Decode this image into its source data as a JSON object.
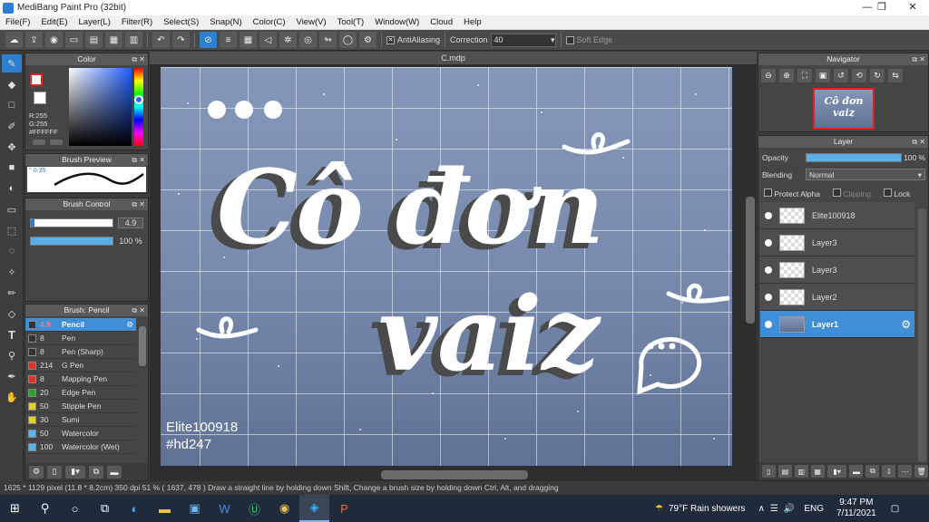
{
  "window": {
    "title": "MediBang Paint Pro (32bit)"
  },
  "menu": [
    "File(F)",
    "Edit(E)",
    "Layer(L)",
    "Filter(R)",
    "Select(S)",
    "Snap(N)",
    "Color(C)",
    "View(V)",
    "Tool(T)",
    "Window(W)",
    "Cloud",
    "Help"
  ],
  "toolbar": {
    "antialiasing_label": "AntiAliasing",
    "correction_label": "Correction",
    "correction_value": "40",
    "soft_edge_label": "Soft Edge"
  },
  "color_panel": {
    "title": "Color",
    "r_label": "R:255",
    "g_label": "G:255",
    "hex_label": "#FFFFFF",
    "primary_color": "#ffffff",
    "accent_color": "#e52222"
  },
  "brush_preview": {
    "title": "Brush Preview",
    "size_text": "0.35"
  },
  "brush_control": {
    "title": "Brush Control",
    "size_value": "4.9",
    "opacity_value": "100 %"
  },
  "brush_list": {
    "title": "Brush: Pencil",
    "items": [
      {
        "size": "4.9",
        "name": "Pencil",
        "color": "#333333",
        "selected": true
      },
      {
        "size": "8",
        "name": "Pen",
        "color": "#333333"
      },
      {
        "size": "8",
        "name": "Pen (Sharp)",
        "color": "#333333"
      },
      {
        "size": "214",
        "name": "G Pen",
        "color": "#e03030"
      },
      {
        "size": "8",
        "name": "Mapping Pen",
        "color": "#e03030"
      },
      {
        "size": "20",
        "name": "Edge Pen",
        "color": "#30a030"
      },
      {
        "size": "50",
        "name": "Stipple Pen",
        "color": "#e0d030"
      },
      {
        "size": "30",
        "name": "Sumi",
        "color": "#e0d030"
      },
      {
        "size": "50",
        "name": "Watercolor",
        "color": "#5ab4e6"
      },
      {
        "size": "100",
        "name": "Watercolor (Wet)",
        "color": "#5ab4e6"
      }
    ]
  },
  "document": {
    "tab": "C.mdp",
    "artwork_text": {
      "line1": "Cô đơn",
      "line2": "vaiz",
      "watermark1": "Elite100918",
      "watermark2": "#hd247"
    }
  },
  "navigator": {
    "title": "Navigator",
    "thumb_text1": "Cô đơn",
    "thumb_text2": "vaiz"
  },
  "layer_panel": {
    "title": "Layer",
    "opacity_label": "Opacity",
    "opacity_value": "100 %",
    "opacity_fraction": 1.0,
    "blending_label": "Blending",
    "blending_value": "Normal",
    "protect_alpha": "Protect Alpha",
    "clipping": "Clipping",
    "lock": "Lock",
    "layers": [
      {
        "name": "Elite100918",
        "selected": false
      },
      {
        "name": "Layer3",
        "selected": false
      },
      {
        "name": "Layer3",
        "selected": false
      },
      {
        "name": "Layer2",
        "selected": false
      },
      {
        "name": "Layer1",
        "selected": true
      }
    ]
  },
  "status": {
    "text": "1625 * 1129 pixel  (11.8 * 8.2cm)  350 dpi  51 %  ( 1637, 478 )  Draw a straight line by holding down Shift, Change a brush size by holding down Ctrl, Alt, and dragging"
  },
  "taskbar": {
    "weather": "79°F  Rain showers",
    "lang": "ENG",
    "time": "9:47 PM",
    "date": "7/11/2021"
  }
}
